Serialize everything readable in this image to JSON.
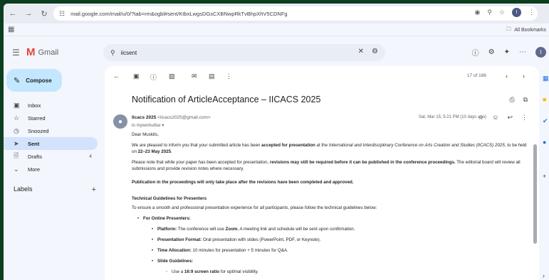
{
  "browser": {
    "url": "mail.google.com/mail/u/0/?tab=rm&ogbl#sent/KtbxLwgsDGsCXBNwpRkTvBhpXhV5CDNFg",
    "back_icon": "arrow-left-icon",
    "forward_icon": "arrow-right-icon",
    "reload_icon": "reload-icon",
    "profile_initial": "I",
    "all_bookmarks": "All Bookmarks"
  },
  "gmail": {
    "app_name": "Gmail",
    "search_query": "iicsent",
    "compose_label": "Compose",
    "account_initial": "I",
    "nav": [
      {
        "label": "Inbox",
        "icon": "inbox-icon",
        "count": ""
      },
      {
        "label": "Starred",
        "icon": "star-icon",
        "count": ""
      },
      {
        "label": "Snoozed",
        "icon": "clock-icon",
        "count": ""
      },
      {
        "label": "Sent",
        "icon": "send-icon",
        "count": "",
        "active": true
      },
      {
        "label": "Drafts",
        "icon": "draft-icon",
        "count": "4"
      },
      {
        "label": "More",
        "icon": "chevron-down-icon",
        "count": ""
      }
    ],
    "labels_title": "Labels"
  },
  "toolbar": {
    "pager": "17 of 186"
  },
  "email": {
    "subject": "Notification of ArticleAcceptance – IICACS 2025",
    "sender_name": "Iicacs 2025",
    "sender_email": "<iicacs2025@gmail.com>",
    "to": "to myworkuttiar",
    "date": "Sat, Mar 15, 5:21 PM (10 days ago)",
    "greeting": "Dear Muskits,",
    "p1_a": "We are pleased to inform you that your submitted article has been ",
    "p1_b": "accepted for presentation",
    "p1_c": " at the ",
    "p1_d": "International and Interdisciplinary Conference on Arts Creation and Studies (IICACS) 2025",
    "p1_e": ", to be held on ",
    "p1_f": "22–23 May 2025",
    "p1_g": ".",
    "p2_a": "Please note that while your paper has been accepted for presentation, ",
    "p2_b": "revisions may still be required before it can be published in the conference proceedings.",
    "p2_c": " The editorial board will review all submissions and provide revision notes where necessary.",
    "p3": "Publication in the proceedings will only take place after the revisions have been completed and approved.",
    "tg_title": "Technical Guidelines for Presenters",
    "tg_intro": "To ensure a smooth and professional presentation experience for all participants, please follow the technical guidelines below:",
    "online_title": "For Online Presenters:",
    "platform_label": "Platform:",
    "platform_a": " The conference will use ",
    "platform_b": "Zoom.",
    "platform_c": " A meeting link and schedule will be sent upon confirmation.",
    "format_label": "Presentation Format:",
    "format_text": " Oral presentation with slides (PowerPoint, PDF, or Keynote).",
    "time_label": "Time Allocation:",
    "time_text": " 10 minutes for presentation + 5 minutes for Q&A.",
    "slide_label": "Slide Guidelines:",
    "slide1_a": "Use a ",
    "slide1_b": "16:9 screen ratio",
    "slide1_c": " for optimal visibility."
  }
}
